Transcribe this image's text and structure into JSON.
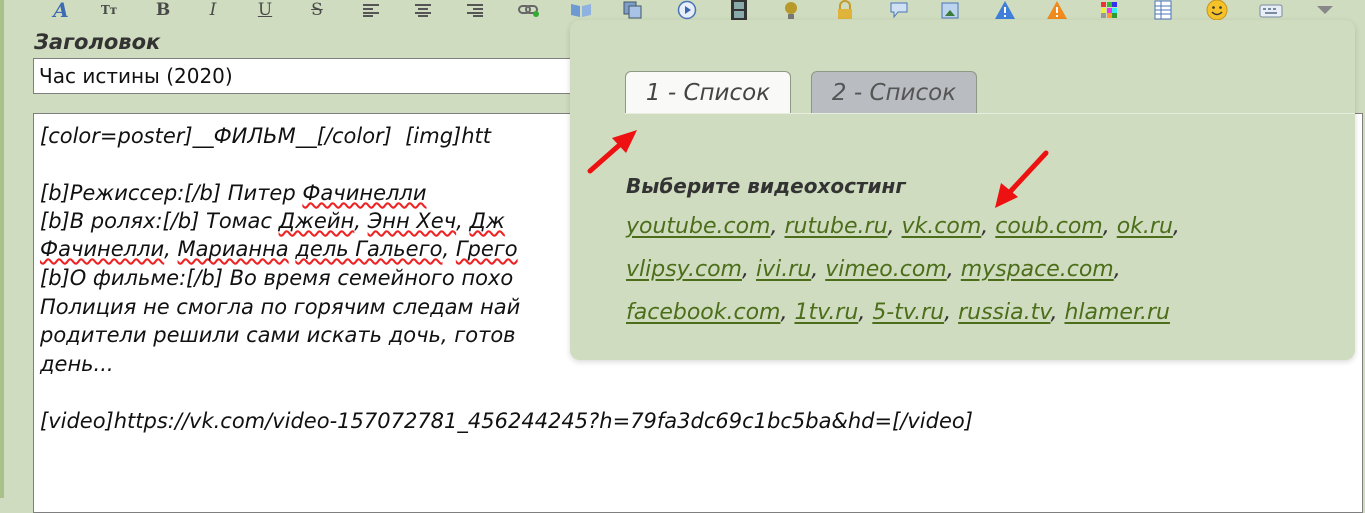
{
  "toolbar": {
    "font_glyph": "A",
    "size_glyph": "Tт",
    "bold_glyph": "B",
    "italic_glyph": "I",
    "underline_glyph": "U",
    "strike_glyph": "S",
    "icons": [
      "align-left-icon",
      "align-center-icon",
      "align-right-icon",
      "link-icon",
      "book-icon",
      "copy-icon",
      "play-icon",
      "film-icon",
      "spoiler-icon",
      "lock-icon",
      "comment-icon",
      "image-icon",
      "warning-blue-icon",
      "warning-orange-icon",
      "color-grid-icon",
      "table-icon",
      "smiley-icon",
      "keyboard-icon",
      "dropdown-arrow-icon"
    ]
  },
  "form": {
    "title_label": "Заголовок",
    "title_value": "Час истины (2020)"
  },
  "editor": {
    "line1": "[color=poster]__ФИЛЬМ__[/color]  [img]htt",
    "l2a": "[b]Режиссер:[/b] Питер ",
    "l2b": "Фачинелли",
    "l3a": "[b]В ролях:[/b] Томас ",
    "l3b": "Джейн",
    "l3c": ", ",
    "l3d": "Энн Хеч",
    "l3e": ", ",
    "l3f": "Дж",
    "l4a": "Фачинелли",
    "l4b": ", ",
    "l4c": "Марианна",
    "l4d": " ",
    "l4e": "дель Гальего",
    "l4f": ", ",
    "l4g": "Грего",
    "line5": "[b]О фильме:[/b] Во время семейного похо",
    "line6": "Полиция не смогла по горячим следам най",
    "line7": "родители решили сами искать дочь, готов",
    "line8": "день...",
    "line9": "[video]https://vk.com/video-157072781_456244245?h=79fa3dc69c1bc5ba&hd=[/video]"
  },
  "popup": {
    "tab1": "1 - Список",
    "tab2": "2 - Список",
    "heading": "Выберите видеохостинг",
    "hosts": [
      "youtube.com",
      "rutube.ru",
      "vk.com",
      "coub.com",
      "ok.ru",
      "vlipsy.com",
      "ivi.ru",
      "vimeo.com",
      "myspace.com",
      "facebook.com",
      "1tv.ru",
      "5-tv.ru",
      "russia.tv",
      "hlamer.ru"
    ],
    "sep": ", ",
    "trail": ","
  },
  "colors": {
    "arrow": "#ee1111",
    "link": "#4c6e1b",
    "panel": "#cfdcbf"
  }
}
